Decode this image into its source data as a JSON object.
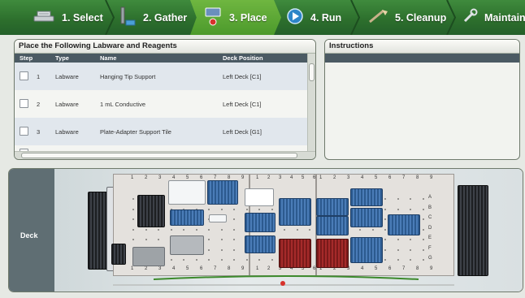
{
  "steps": [
    {
      "label": "1. Select",
      "icon": "select-icon",
      "active": false
    },
    {
      "label": "2. Gather",
      "icon": "pipette-icon",
      "active": false
    },
    {
      "label": "3. Place",
      "icon": "place-icon",
      "active": true
    },
    {
      "label": "4. Run",
      "icon": "run-icon",
      "active": false
    },
    {
      "label": "5. Cleanup",
      "icon": "cleanup-icon",
      "active": false
    },
    {
      "label": "Maintain",
      "icon": "wrench-icon",
      "active": false
    }
  ],
  "labware_panel": {
    "title": "Place the Following Labware and Reagents",
    "columns": [
      "Step",
      "Type",
      "Name",
      "Deck Position"
    ],
    "rows": [
      {
        "step": "1",
        "type": "Labware",
        "name": "Hanging Tip Support",
        "position": "Left Deck [C1]"
      },
      {
        "step": "2",
        "type": "Labware",
        "name": "1 mL Conductive",
        "position": "Left Deck [C1]"
      },
      {
        "step": "3",
        "type": "Labware",
        "name": "Plate-Adapter Support Tile",
        "position": "Left Deck [G1]"
      }
    ]
  },
  "instructions_panel": {
    "title": "Instructions"
  },
  "deck": {
    "label": "Deck",
    "column_numbers": [
      "1",
      "2",
      "3",
      "4",
      "5",
      "6",
      "7",
      "8",
      "9"
    ],
    "row_letters": [
      "A",
      "B",
      "C",
      "D",
      "E",
      "F",
      "G"
    ],
    "colors": {
      "blue": "#3b6aa5",
      "red": "#a52a2a",
      "dark": "#2b2e33",
      "active_step": "#5da835"
    }
  }
}
